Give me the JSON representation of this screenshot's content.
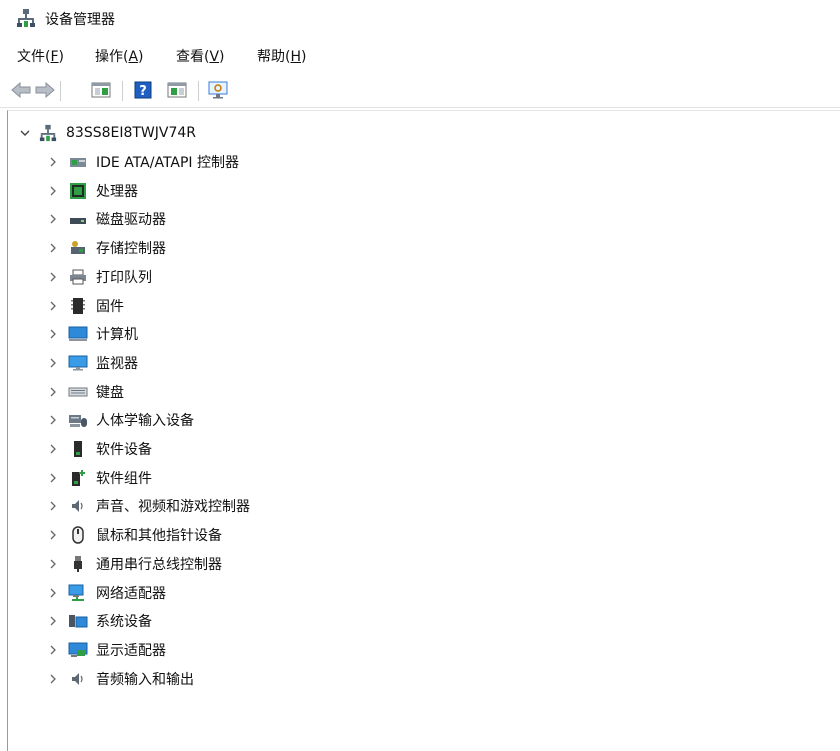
{
  "window": {
    "title": "设备管理器"
  },
  "menu": [
    {
      "text": "文件(",
      "key": "F",
      "end": ")"
    },
    {
      "text": "操作(",
      "key": "A",
      "end": ")"
    },
    {
      "text": "查看(",
      "key": "V",
      "end": ")"
    },
    {
      "text": "帮助(",
      "key": "H",
      "end": ")"
    }
  ],
  "tree": {
    "root": "83SS8EI8TWJV74R",
    "items": [
      "IDE ATA/ATAPI 控制器",
      "处理器",
      "磁盘驱动器",
      "存储控制器",
      "打印队列",
      "固件",
      "计算机",
      "监视器",
      "键盘",
      "人体学输入设备",
      "软件设备",
      "软件组件",
      "声音、视频和游戏控制器",
      "鼠标和其他指针设备",
      "通用串行总线控制器",
      "网络适配器",
      "系统设备",
      "显示适配器",
      "音频输入和输出"
    ]
  }
}
